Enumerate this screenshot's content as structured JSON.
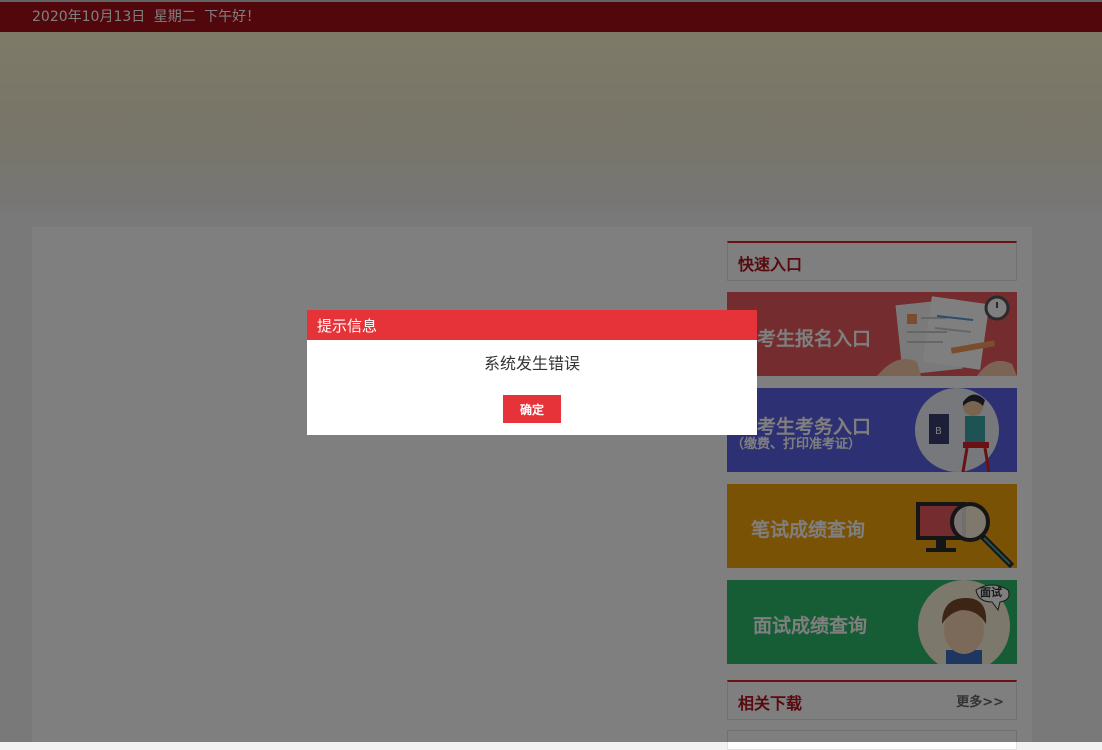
{
  "topbar": {
    "date_greeting": "2020年10月13日  星期二  下午好！"
  },
  "sidebar": {
    "quick_entry_title": "快速入口",
    "cards": [
      {
        "label": "考生报名入口",
        "color": "#e8585e"
      },
      {
        "label": "考生考务入口",
        "sub": "（缴费、打印准考证）",
        "color": "#5b61e5"
      },
      {
        "label": "笔试成绩查询",
        "color": "#f5a40a"
      },
      {
        "label": "面试成绩查询",
        "color": "#2db96a",
        "badge": "面试"
      }
    ],
    "downloads_title": "相关下载",
    "more_link": "更多>>"
  },
  "dialog": {
    "title": "提示信息",
    "message": "系统发生错误",
    "confirm_label": "确定"
  },
  "colors": {
    "topbar": "#a50f18",
    "accent_red": "#e6333a",
    "title_red": "#b0141c"
  }
}
